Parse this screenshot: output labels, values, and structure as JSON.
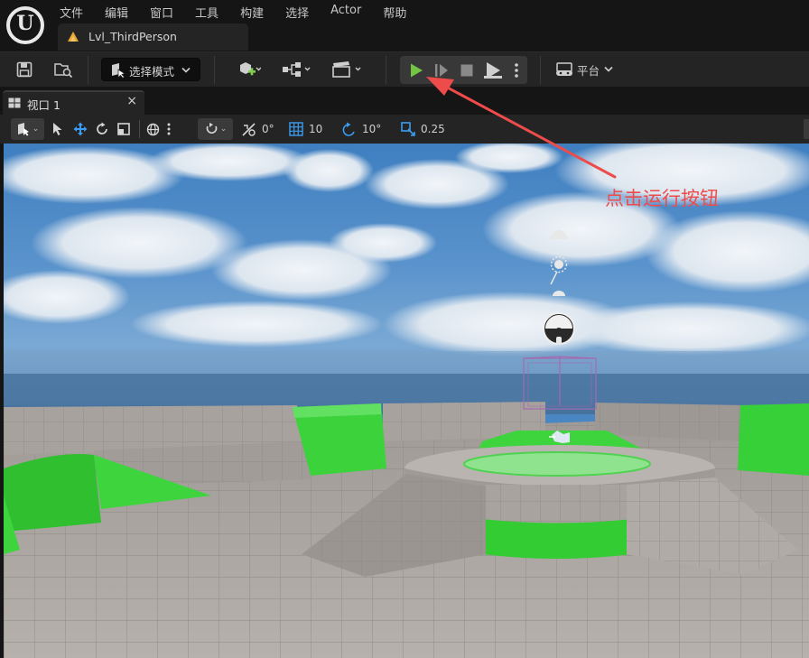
{
  "app": {
    "logo_letter": "U"
  },
  "menu": {
    "items": [
      "文件",
      "编辑",
      "窗口",
      "工具",
      "构建",
      "选择",
      "Actor",
      "帮助"
    ]
  },
  "level_tab": {
    "label": "Lvl_ThirdPerson"
  },
  "toolbar": {
    "mode_label": "选择模式",
    "platform_label": "平台",
    "icons": [
      "save-icon",
      "content-browser-icon",
      "add-actor-icon",
      "blueprint-icon",
      "cinematics-icon",
      "play-icon",
      "advance-frame-icon",
      "stop-icon",
      "launch-icon",
      "more-options-icon",
      "platform-icon"
    ],
    "accent_play": "#72c442"
  },
  "viewport_tab": {
    "label": "视口 1",
    "close": "×"
  },
  "viewport_toolbar": {
    "rotation_snap_value": "0°",
    "grid_snap_value": "10",
    "angle_snap_value": "10°",
    "scale_snap_value": "0.25"
  },
  "annotation": {
    "text": "点击运行按钮",
    "color": "#ee4b4b"
  }
}
